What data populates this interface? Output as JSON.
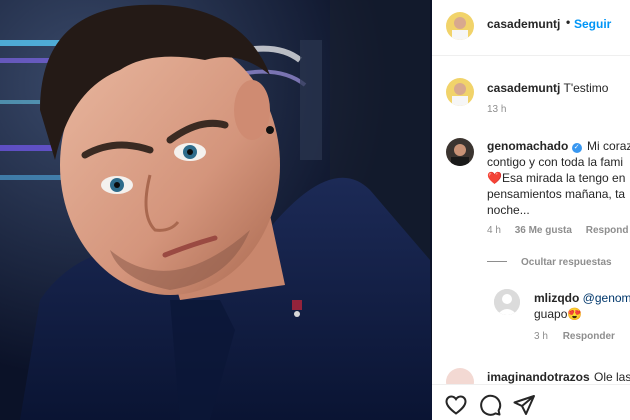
{
  "post": {
    "author": "casademuntj",
    "follow_label": "Seguir",
    "dot": "•",
    "caption_text": "T'estimo",
    "caption_time": "13 h"
  },
  "comment": {
    "author": "genomachado",
    "verified_icon": "verified-badge-icon",
    "line1_rest": "Mi coraz",
    "line2": "contigo y con toda la fami",
    "line3": "Esa mirada la tengo en",
    "line3_emoji": "❤️",
    "line4": "pensamientos mañana, ta",
    "line5": "noche...",
    "time": "4 h",
    "likes": "36 Me gusta",
    "reply_label": "Respond",
    "hide_replies": "Ocultar respuestas"
  },
  "reply": {
    "author": "mlizqdo",
    "mention": "@genom",
    "line2": "guapo",
    "emoji": "😍",
    "time": "3 h",
    "reply_label": "Responder"
  },
  "next_comment": {
    "author": "imaginandotrazos",
    "text": "Ole las"
  },
  "icons": {
    "like": "heart-icon",
    "comment": "comment-icon",
    "share": "share-icon"
  },
  "colors": {
    "link": "#0095f6",
    "muted": "#8e8e8e",
    "verified": "#3897f0",
    "heart": "#ed4956"
  }
}
